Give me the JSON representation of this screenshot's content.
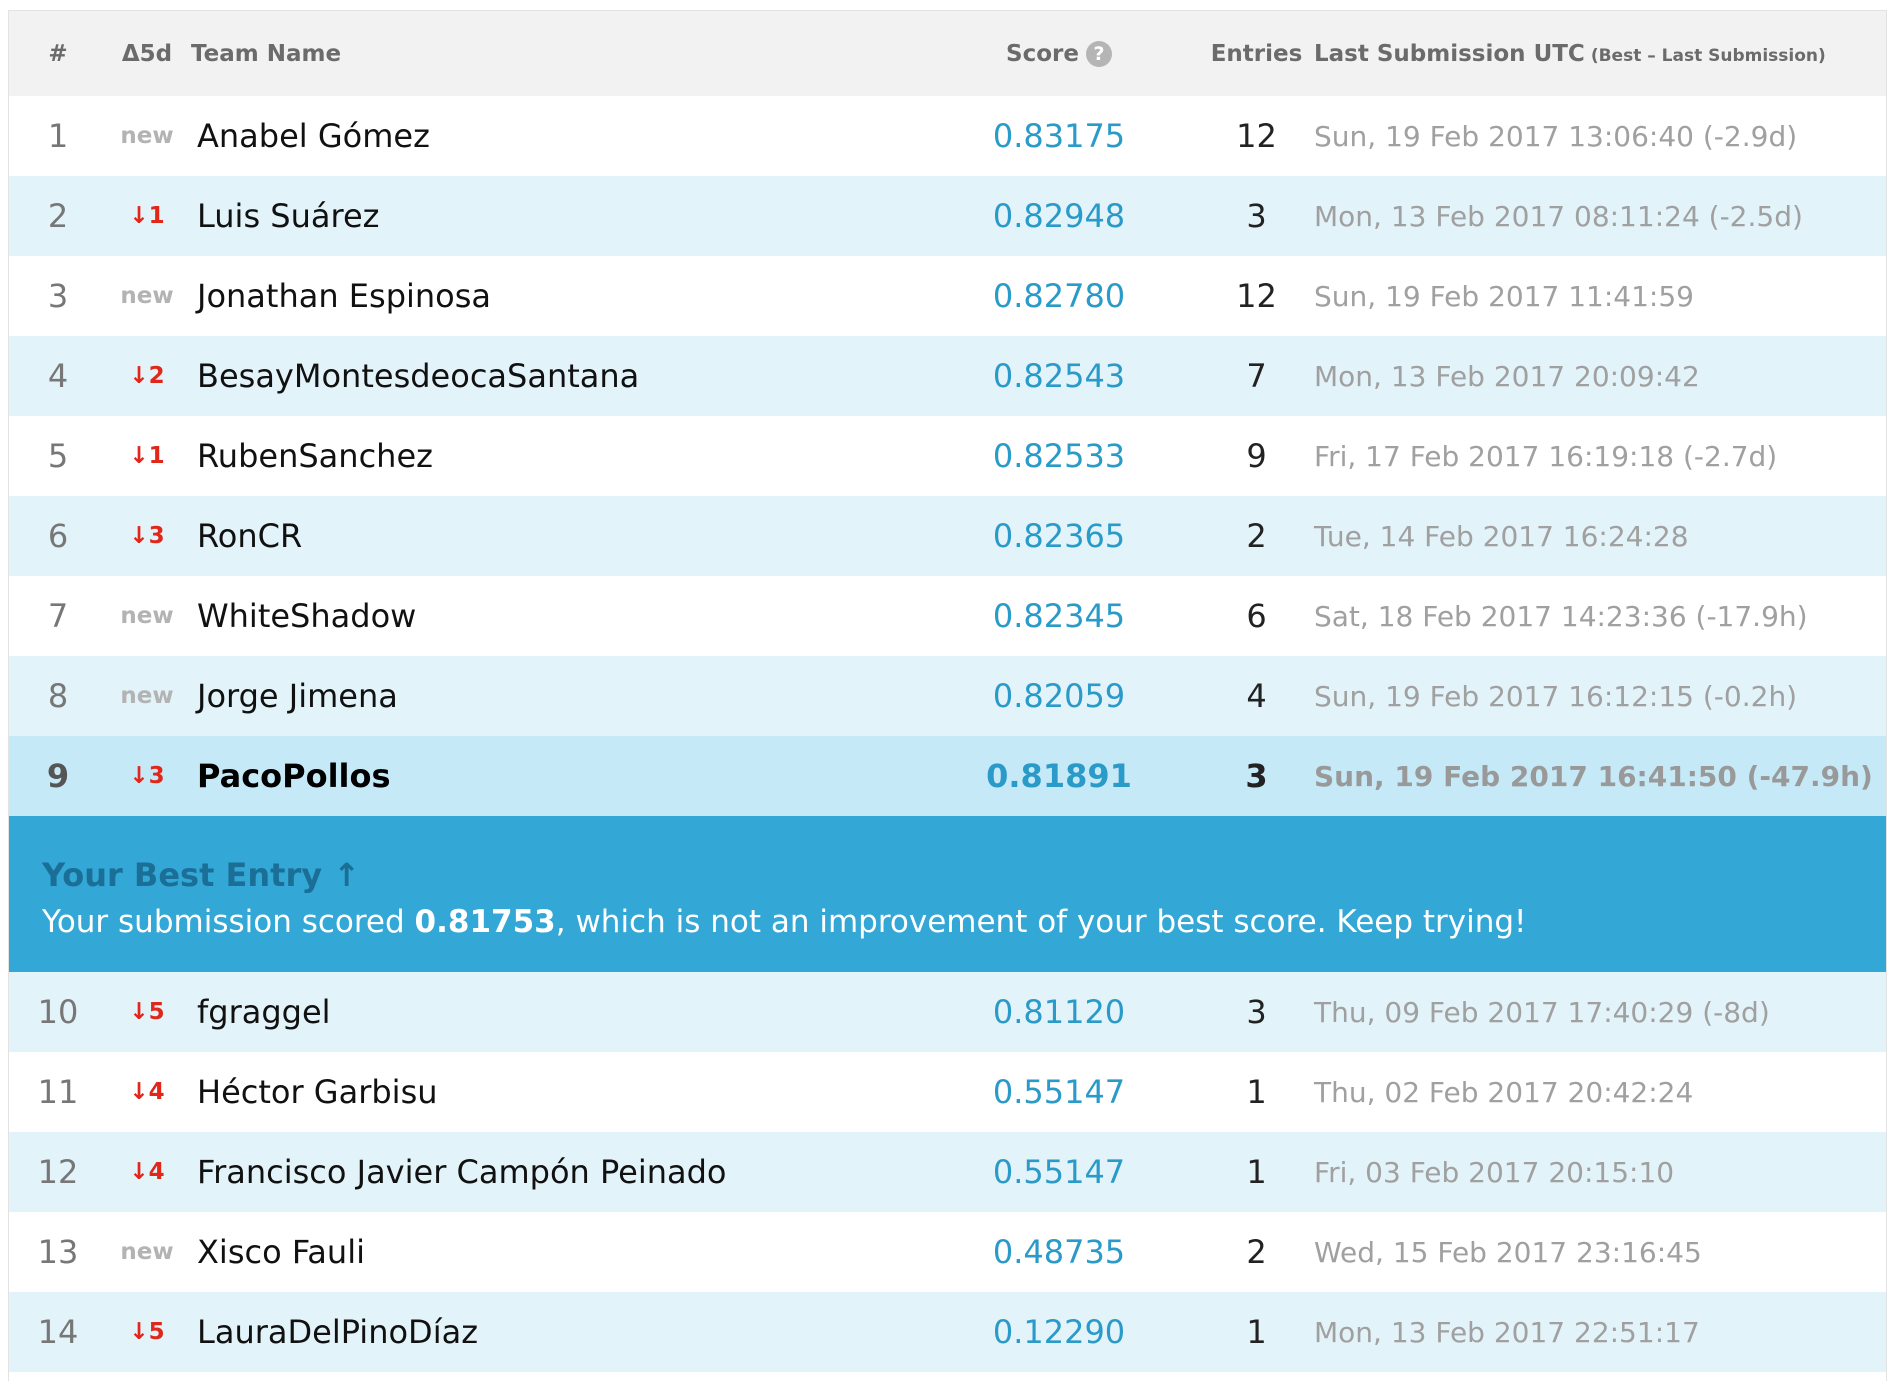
{
  "header": {
    "rank": "#",
    "delta": "Δ5d",
    "team": "Team Name",
    "score": "Score",
    "entries": "Entries",
    "last": "Last Submission UTC",
    "last_sub": "(Best – Last Submission)"
  },
  "rows": [
    {
      "rank": "1",
      "delta": "new",
      "team": "Anabel Gómez",
      "score": "0.83175",
      "entries": "12",
      "last": "Sun, 19 Feb 2017 13:06:40 (-2.9d)"
    },
    {
      "rank": "2",
      "delta": "↓1",
      "team": "Luis Suárez",
      "score": "0.82948",
      "entries": "3",
      "last": "Mon, 13 Feb 2017 08:11:24 (-2.5d)"
    },
    {
      "rank": "3",
      "delta": "new",
      "team": "Jonathan Espinosa",
      "score": "0.82780",
      "entries": "12",
      "last": "Sun, 19 Feb 2017 11:41:59"
    },
    {
      "rank": "4",
      "delta": "↓2",
      "team": "BesayMontesdeocaSantana",
      "score": "0.82543",
      "entries": "7",
      "last": "Mon, 13 Feb 2017 20:09:42"
    },
    {
      "rank": "5",
      "delta": "↓1",
      "team": "RubenSanchez",
      "score": "0.82533",
      "entries": "9",
      "last": "Fri, 17 Feb 2017 16:19:18 (-2.7d)"
    },
    {
      "rank": "6",
      "delta": "↓3",
      "team": "RonCR",
      "score": "0.82365",
      "entries": "2",
      "last": "Tue, 14 Feb 2017 16:24:28"
    },
    {
      "rank": "7",
      "delta": "new",
      "team": "WhiteShadow",
      "score": "0.82345",
      "entries": "6",
      "last": "Sat, 18 Feb 2017 14:23:36 (-17.9h)"
    },
    {
      "rank": "8",
      "delta": "new",
      "team": "Jorge Jimena",
      "score": "0.82059",
      "entries": "4",
      "last": "Sun, 19 Feb 2017 16:12:15 (-0.2h)"
    },
    {
      "rank": "9",
      "delta": "↓3",
      "team": "PacoPollos",
      "score": "0.81891",
      "entries": "3",
      "last": "Sun, 19 Feb 2017 16:41:50 (-47.9h)"
    },
    {
      "rank": "10",
      "delta": "↓5",
      "team": "fgraggel",
      "score": "0.81120",
      "entries": "3",
      "last": "Thu, 09 Feb 2017 17:40:29 (-8d)"
    },
    {
      "rank": "11",
      "delta": "↓4",
      "team": "Héctor Garbisu",
      "score": "0.55147",
      "entries": "1",
      "last": "Thu, 02 Feb 2017 20:42:24"
    },
    {
      "rank": "12",
      "delta": "↓4",
      "team": "Francisco Javier Campón Peinado",
      "score": "0.55147",
      "entries": "1",
      "last": "Fri, 03 Feb 2017 20:15:10"
    },
    {
      "rank": "13",
      "delta": "new",
      "team": "Xisco Fauli",
      "score": "0.48735",
      "entries": "2",
      "last": "Wed, 15 Feb 2017 23:16:45"
    },
    {
      "rank": "14",
      "delta": "↓5",
      "team": "LauraDelPinoDíaz",
      "score": "0.12290",
      "entries": "1",
      "last": "Mon, 13 Feb 2017 22:51:17"
    }
  ],
  "banner": {
    "title": "Your Best Entry ↑",
    "msg_prefix": "Your submission scored ",
    "msg_score": "0.81753",
    "msg_suffix": ", which is not an improvement of your best score. Keep trying!"
  },
  "colors": {
    "score_link": "#2a9ac9",
    "delta_down": "#e0271a",
    "banner_bg": "#33a7d6",
    "row_alt": "#e3f3fa",
    "row_self": "#c5e9f7"
  },
  "icons": {
    "score_help": "question-circle-icon"
  }
}
